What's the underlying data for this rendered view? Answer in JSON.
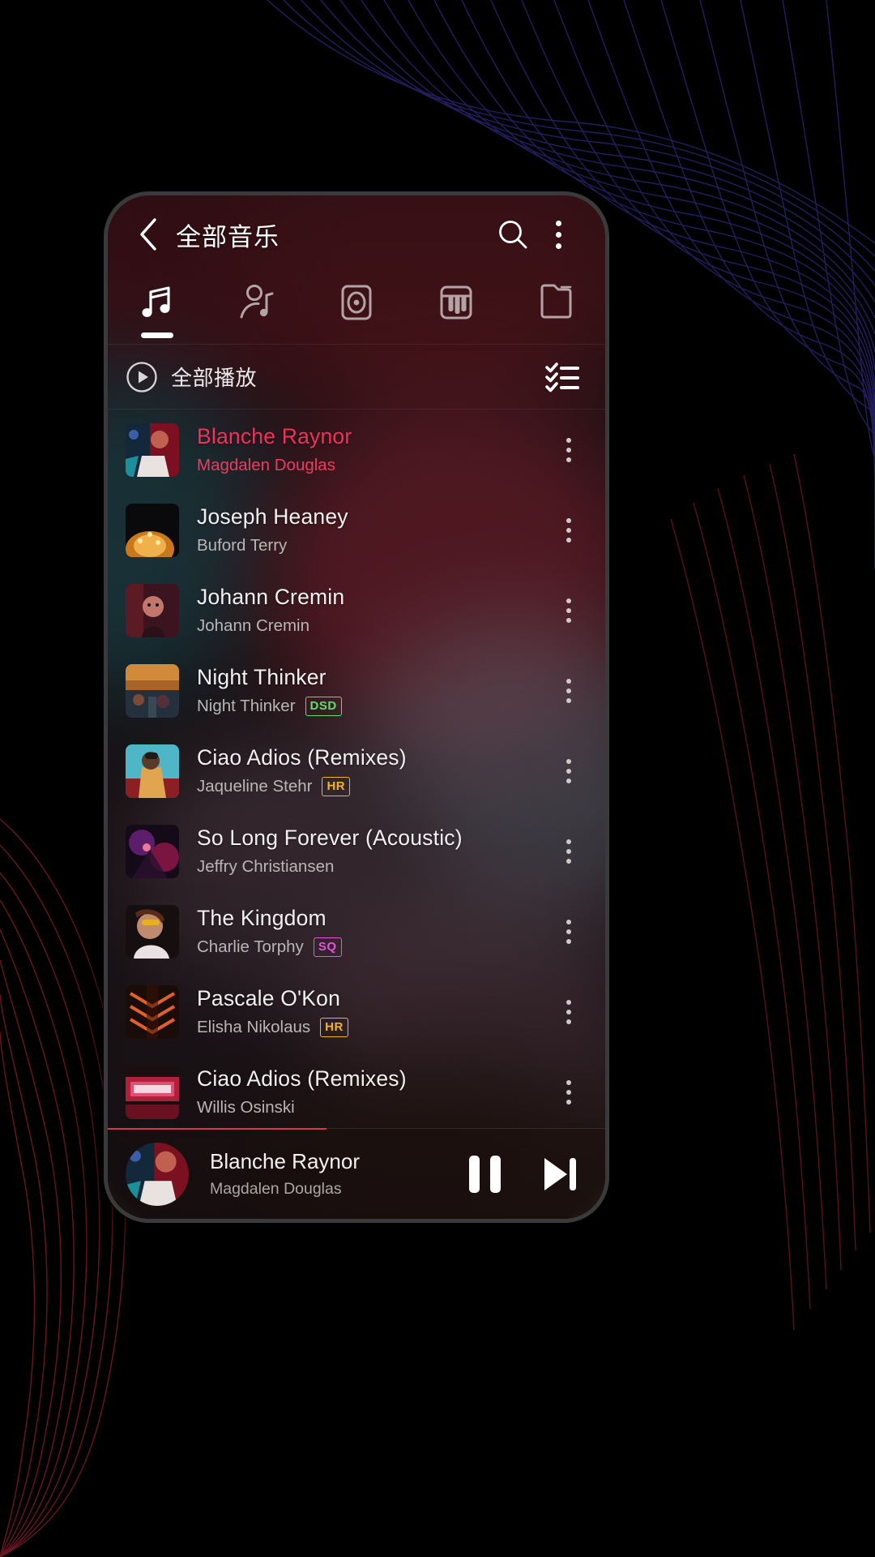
{
  "header": {
    "back_icon": "chevron-left-icon",
    "title": "全部音乐",
    "search_icon": "search-icon",
    "overflow_icon": "kebab-menu-icon"
  },
  "tabs": [
    {
      "name": "songs",
      "icon": "music-note-icon",
      "active": true
    },
    {
      "name": "artists",
      "icon": "artist-icon",
      "active": false
    },
    {
      "name": "albums",
      "icon": "album-disc-icon",
      "active": false
    },
    {
      "name": "instruments",
      "icon": "piano-icon",
      "active": false
    },
    {
      "name": "folders",
      "icon": "folder-icon",
      "active": false
    }
  ],
  "playall": {
    "play_icon": "play-circle-icon",
    "label": "全部播放",
    "select_icon": "checklist-icon"
  },
  "songs": [
    {
      "title": "Blanche Raynor",
      "artist": "Magdalen Douglas",
      "badge": "",
      "playing": true
    },
    {
      "title": "Joseph Heaney",
      "artist": "Buford Terry",
      "badge": "",
      "playing": false
    },
    {
      "title": "Johann Cremin",
      "artist": "Johann Cremin",
      "badge": "",
      "playing": false
    },
    {
      "title": "Night Thinker",
      "artist": "Night Thinker",
      "badge": "DSD",
      "playing": false
    },
    {
      "title": "Ciao Adios (Remixes)",
      "artist": "Jaqueline Stehr",
      "badge": "HR",
      "playing": false
    },
    {
      "title": "So Long Forever (Acoustic)",
      "artist": "Jeffry Christiansen",
      "badge": "",
      "playing": false
    },
    {
      "title": "The Kingdom",
      "artist": "Charlie Torphy",
      "badge": "SQ",
      "playing": false
    },
    {
      "title": "Pascale O'Kon",
      "artist": "Elisha Nikolaus",
      "badge": "HR",
      "playing": false
    },
    {
      "title": "Ciao Adios (Remixes)",
      "artist": "Willis Osinski",
      "badge": "",
      "playing": false
    }
  ],
  "miniplayer": {
    "title": "Blanche Raynor",
    "artist": "Magdalen Douglas",
    "pause_icon": "pause-icon",
    "next_icon": "skip-next-icon"
  },
  "colors": {
    "accent_pink": "#f4305e",
    "badge_dsd": "#5ce06a",
    "badge_hr": "#f0b427",
    "badge_sq": "#e652e0",
    "progress": "#d8354f"
  }
}
